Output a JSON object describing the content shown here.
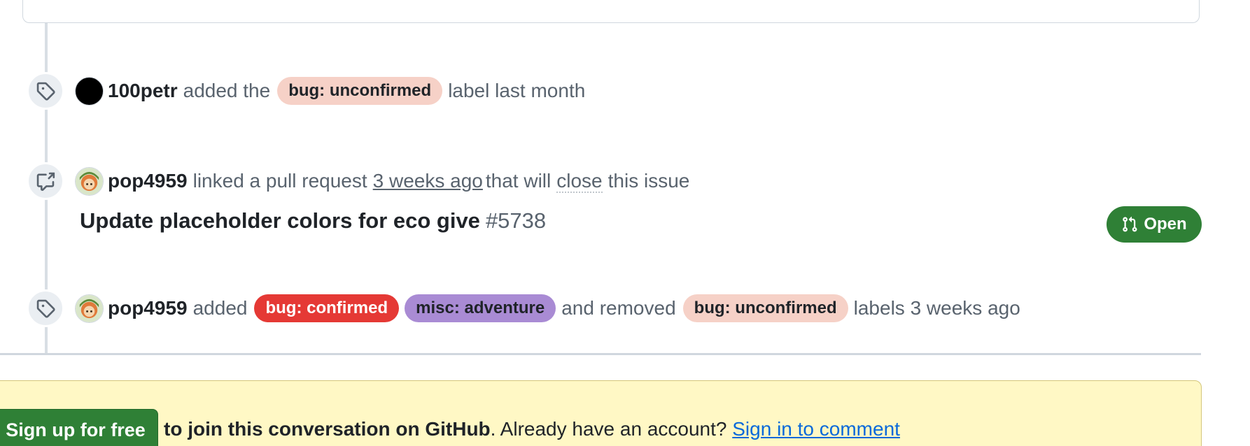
{
  "events": [
    {
      "icon": "tag-icon",
      "author": "100petr",
      "pre_text": "added the",
      "label": {
        "text": "bug: unconfirmed",
        "color": "#f6d1c7",
        "text_color": "#1f2328"
      },
      "post_text": "label last month"
    },
    {
      "icon": "cross-reference-icon",
      "author": "pop4959",
      "pre_text": "linked a pull request",
      "time": "3 weeks ago",
      "mid_text": "that will",
      "close_word": "close",
      "post_text": "this issue",
      "pr": {
        "title": "Update placeholder colors for eco give",
        "number": "#5738",
        "state": "Open",
        "state_color": "#2f8036"
      }
    },
    {
      "icon": "tag-icon",
      "author": "pop4959",
      "pre_text": "added",
      "added_labels": [
        {
          "text": "bug: confirmed",
          "color": "#e53935",
          "text_color": "#ffffff"
        },
        {
          "text": "misc: adventure",
          "color": "#a98bd4",
          "text_color": "#1f2328"
        }
      ],
      "mid_text": "and removed",
      "removed_label": {
        "text": "bug: unconfirmed",
        "color": "#f6d1c7",
        "text_color": "#1f2328"
      },
      "post_text": "labels 3 weeks ago"
    }
  ],
  "footer": {
    "signup_button": "Sign up for free",
    "join_text": "to join this conversation on GitHub",
    "account_text": ". Already have an account?",
    "signin_link": "Sign in to comment"
  }
}
